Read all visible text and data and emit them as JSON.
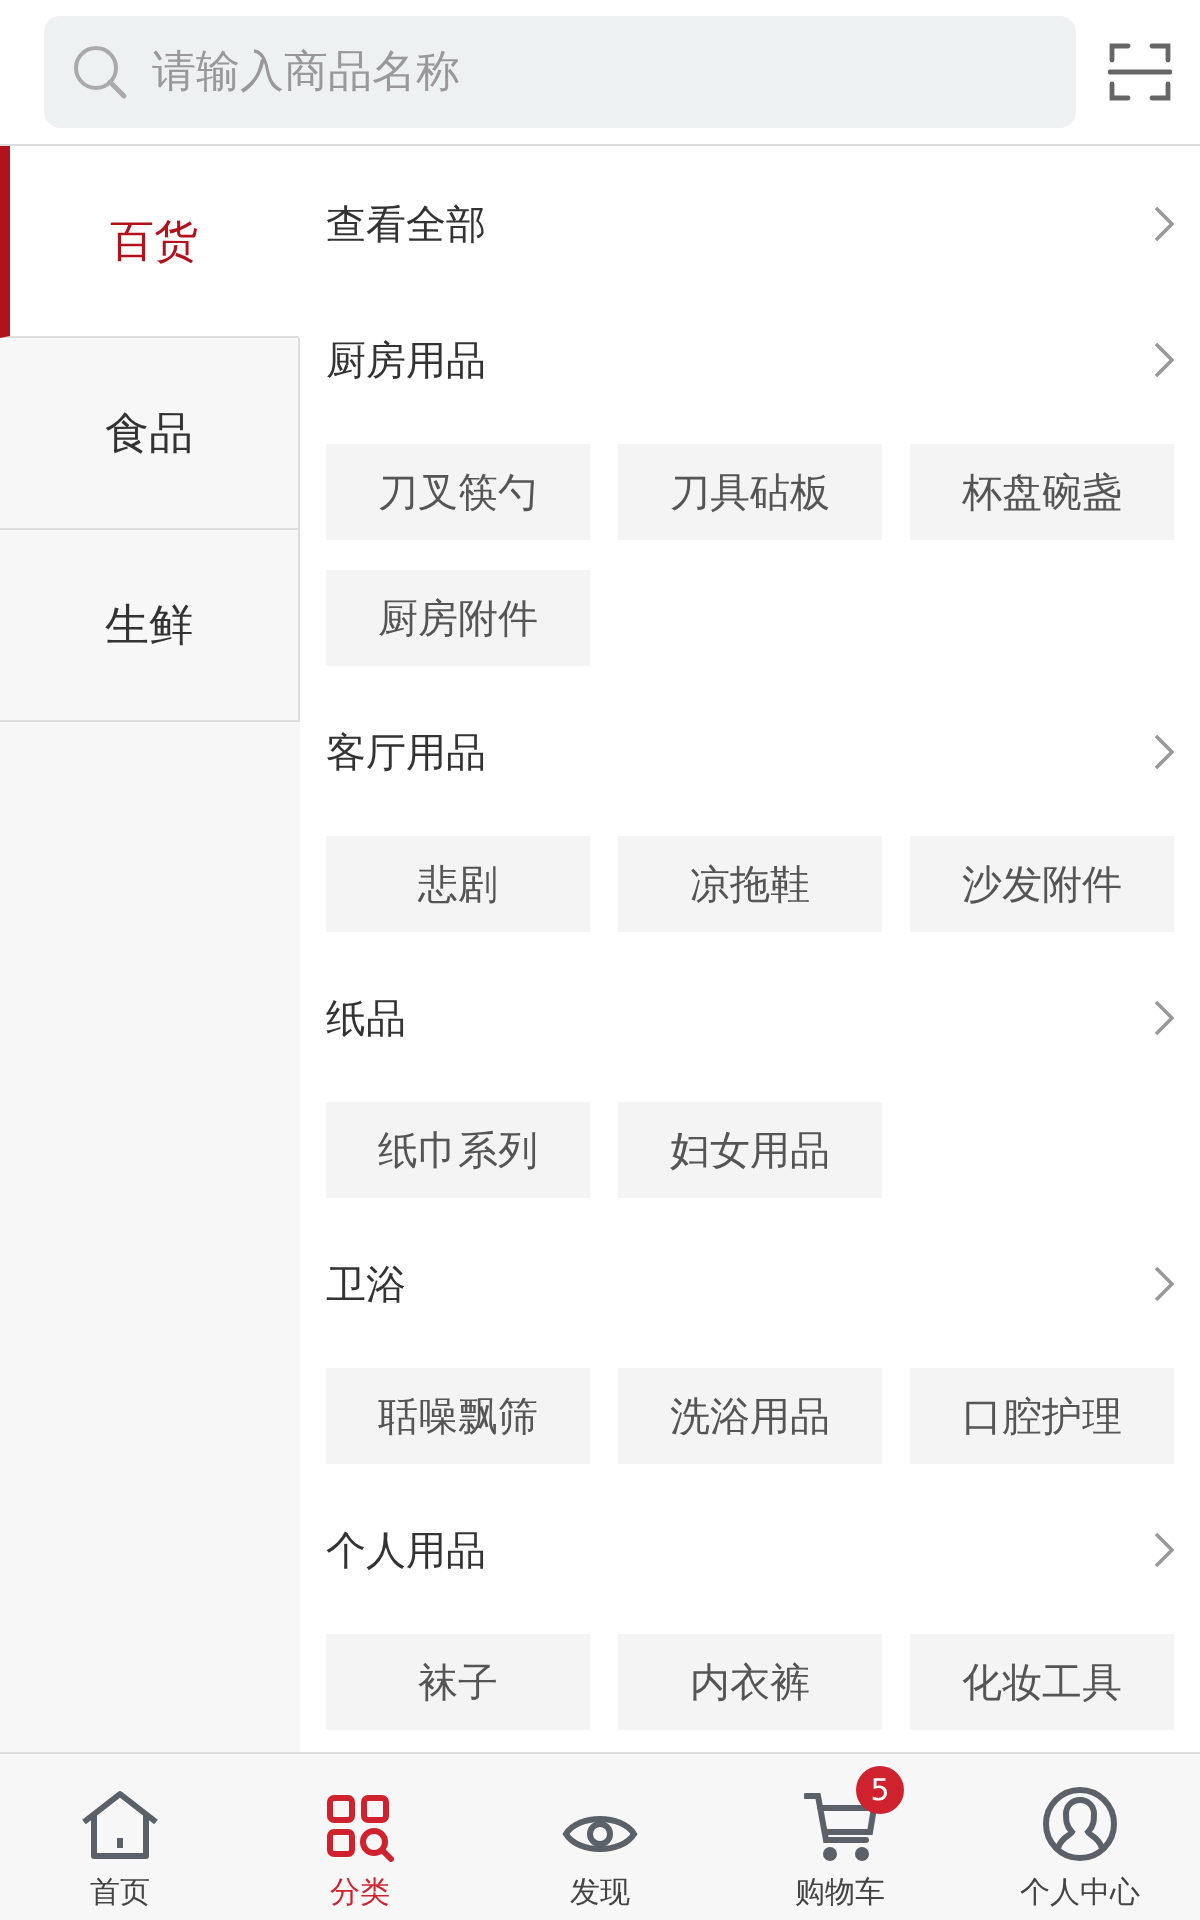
{
  "search": {
    "placeholder": "请输入商品名称"
  },
  "categories": [
    {
      "label": "百货",
      "selected": true
    },
    {
      "label": "食品",
      "selected": false
    },
    {
      "label": "生鲜",
      "selected": false
    }
  ],
  "sections": [
    {
      "title": "查看全部"
    },
    {
      "title": "厨房用品",
      "items": [
        "刀叉筷勺",
        "刀具砧板",
        "杯盘碗盏",
        "厨房附件"
      ]
    },
    {
      "title": "客厅用品",
      "items": [
        "悲剧",
        "凉拖鞋",
        "沙发附件"
      ]
    },
    {
      "title": "纸品",
      "items": [
        "纸巾系列",
        "妇女用品"
      ]
    },
    {
      "title": "卫浴",
      "items": [
        "聒噪飘筛",
        "洗浴用品",
        "口腔护理"
      ]
    },
    {
      "title": "个人用品",
      "items": [
        "袜子",
        "内衣裤",
        "化妆工具"
      ]
    }
  ],
  "tabs": [
    {
      "label": "首页",
      "selected": false
    },
    {
      "label": "分类",
      "selected": true
    },
    {
      "label": "发现",
      "selected": false
    },
    {
      "label": "购物车",
      "selected": false,
      "badge": "5"
    },
    {
      "label": "个人中心",
      "selected": false
    }
  ]
}
